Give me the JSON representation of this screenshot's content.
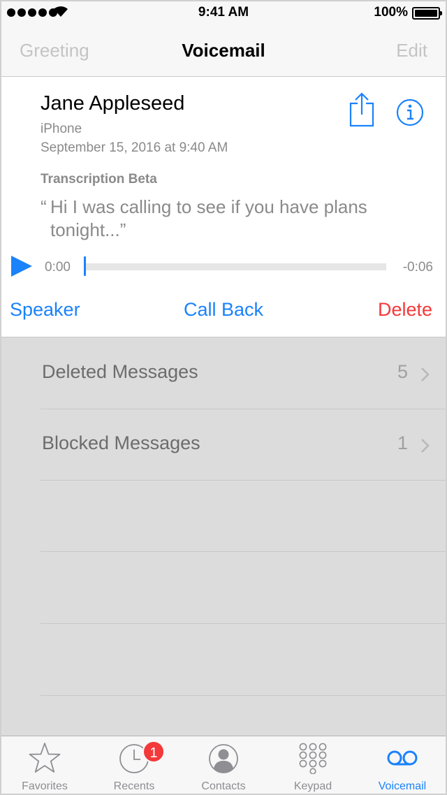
{
  "status_bar": {
    "time": "9:41 AM",
    "battery_percent": "100%",
    "signal_bars": 5,
    "battery_level": 1.0
  },
  "nav": {
    "left": "Greeting",
    "title": "Voicemail",
    "right": "Edit"
  },
  "voicemail": {
    "caller": "Jane Appleseed",
    "device": "iPhone",
    "date": "September 15, 2016 at 9:40 AM",
    "transcription_label": "Transcription Beta",
    "transcript_quote_open": "“",
    "transcript_text": "Hi I was calling to see if you have plans tonight...”",
    "time_elapsed": "0:00",
    "time_remaining": "-0:06",
    "progress": 0.0,
    "actions": {
      "speaker": "Speaker",
      "call_back": "Call Back",
      "delete": "Delete"
    }
  },
  "lists": [
    {
      "label": "Deleted Messages",
      "count": "5"
    },
    {
      "label": "Blocked Messages",
      "count": "1"
    }
  ],
  "tabs": [
    {
      "label": "Favorites",
      "icon": "star-icon",
      "active": false
    },
    {
      "label": "Recents",
      "icon": "clock-icon",
      "active": false,
      "badge": "1"
    },
    {
      "label": "Contacts",
      "icon": "contacts-icon",
      "active": false
    },
    {
      "label": "Keypad",
      "icon": "keypad-icon",
      "active": false
    },
    {
      "label": "Voicemail",
      "icon": "voicemail-icon",
      "active": true
    }
  ],
  "colors": {
    "accent": "#1a82fb",
    "destructive": "#f3393a",
    "secondary_text": "#8a8a8a",
    "inactive": "#8e8e93"
  }
}
